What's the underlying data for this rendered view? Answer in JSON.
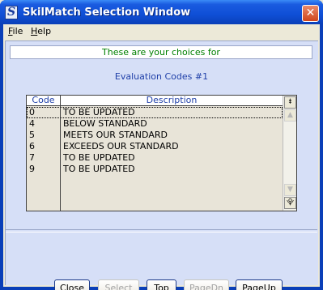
{
  "window": {
    "title": "SkilMatch Selection Window",
    "app_icon_letter": "S",
    "close_glyph": "✕"
  },
  "menu": {
    "file": "File",
    "file_mn": "F",
    "file_rest": "ile",
    "help": "Help",
    "help_mn": "H",
    "help_rest": "elp"
  },
  "header": {
    "text": "These are your choices for"
  },
  "subtitle": "Evaluation Codes #1",
  "table": {
    "columns": [
      "Code",
      "Description"
    ],
    "rows": [
      {
        "code": "0",
        "desc": "TO BE UPDATED"
      },
      {
        "code": "4",
        "desc": "BELOW STANDARD"
      },
      {
        "code": "5",
        "desc": "MEETS OUR STANDARD"
      },
      {
        "code": "6",
        "desc": "EXCEEDS OUR STANDARD"
      },
      {
        "code": "7",
        "desc": "TO BE UPDATED"
      },
      {
        "code": "9",
        "desc": "TO BE UPDATED"
      }
    ]
  },
  "scroll": {
    "top_glyph": "⯒",
    "up_glyph": "▲",
    "down_glyph": "▼",
    "bottom_glyph": "⯓"
  },
  "buttons": {
    "close": "Close",
    "select": "Select",
    "top": "Top",
    "pagedn": "PageDn",
    "pageup": "PageUp"
  },
  "colors": {
    "title_blue": "#0a3fb8",
    "panel": "#d6dff7",
    "header_green": "#008000",
    "label_blue": "#1f3fa8"
  }
}
